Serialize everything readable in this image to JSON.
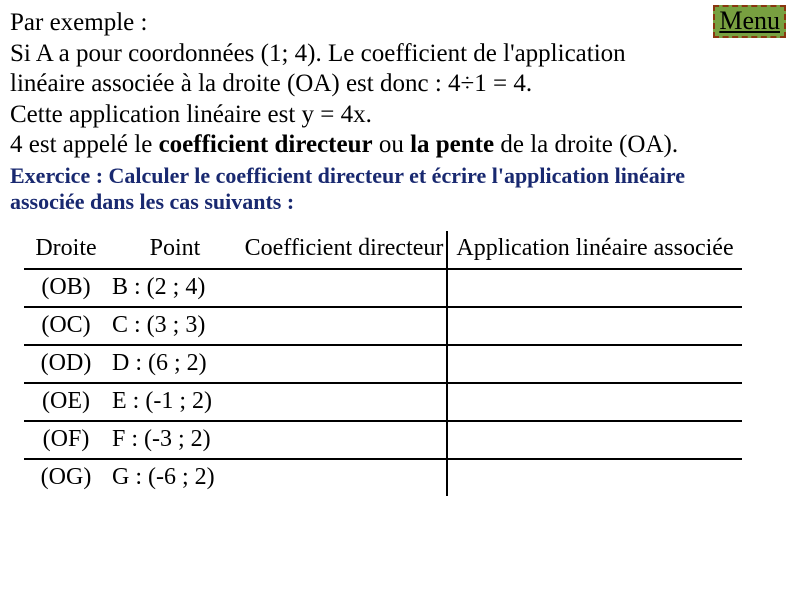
{
  "menu_label": "Menu",
  "paragraph": {
    "line1": "Par exemple :",
    "line2_pre": "Si A a pour coordonnées (1; 4). Le coefficient de l'application",
    "line3": "linéaire associée à la droite (OA) est donc : 4÷1 = 4.",
    "line4": "Cette application linéaire est y = 4x.",
    "line5_a": "4 est appelé le ",
    "line5_b": "coefficient directeur",
    "line5_c": " ou ",
    "line5_d": "la pente",
    "line5_e": " de la droite (OA)."
  },
  "exercise": {
    "line1": "Exercice : Calculer le coefficient directeur et écrire l'application linéaire",
    "line2": "associée dans les cas suivants :"
  },
  "table": {
    "headers": {
      "droite": "Droite",
      "point": "Point",
      "coef": "Coefficient directeur",
      "app": "Application linéaire associée"
    },
    "rows": [
      {
        "droite": "(OB)",
        "point": "B : (2 ; 4)"
      },
      {
        "droite": "(OC)",
        "point": "C : (3 ; 3)"
      },
      {
        "droite": "(OD)",
        "point": "D : (6 ; 2)"
      },
      {
        "droite": "(OE)",
        "point": "E : (-1 ; 2)"
      },
      {
        "droite": "(OF)",
        "point": "F : (-3 ; 2)"
      },
      {
        "droite": "(OG)",
        "point": "G : (-6 ; 2)"
      }
    ]
  }
}
